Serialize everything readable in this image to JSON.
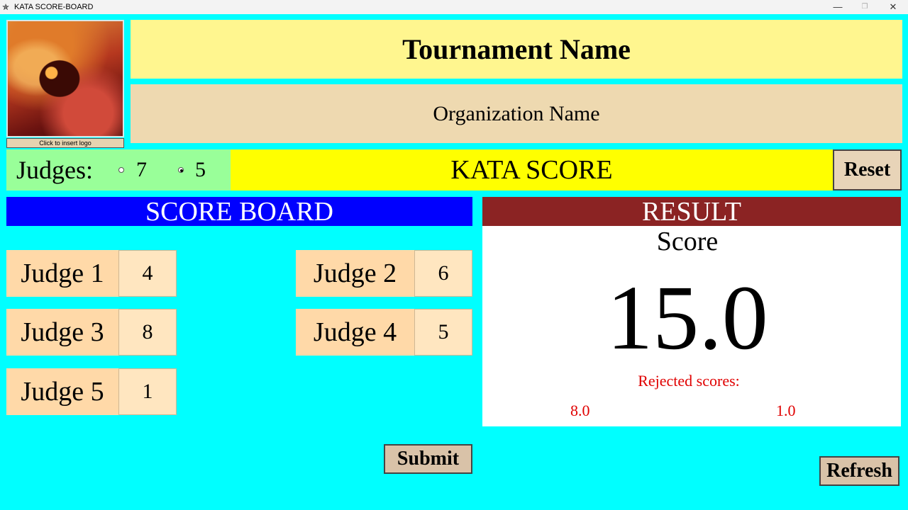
{
  "window": {
    "title": "KATA SCORE-BOARD",
    "icon": "app-icon",
    "minimize": "—",
    "maximize": "❐",
    "close": "✕"
  },
  "logo": {
    "button_label": "Click to insert logo"
  },
  "header": {
    "tournament_name": "Tournament Name",
    "organization_name": "Organization Name"
  },
  "judges_selector": {
    "label": "Judges:",
    "options": [
      {
        "label": "7",
        "selected": false
      },
      {
        "label": "5",
        "selected": true
      }
    ]
  },
  "kata_score_title": "KATA SCORE",
  "reset_label": "Reset",
  "scoreboard": {
    "title": "SCORE BOARD",
    "judges": [
      {
        "label": "Judge 1",
        "value": "4"
      },
      {
        "label": "Judge 2",
        "value": "6"
      },
      {
        "label": "Judge 3",
        "value": "8"
      },
      {
        "label": "Judge 4",
        "value": "5"
      },
      {
        "label": "Judge 5",
        "value": "1"
      }
    ]
  },
  "result": {
    "title": "RESULT",
    "score_label": "Score",
    "score_value": "15.0",
    "rejected_label": "Rejected scores:",
    "rejected": [
      "8.0",
      "1.0"
    ]
  },
  "submit_label": "Submit",
  "refresh_label": "Refresh",
  "colors": {
    "background": "#00ffff",
    "tournament_bg": "#fff68f",
    "organization_bg": "#eed9b0",
    "judges_bg": "#99ff99",
    "kata_bg": "#ffff00",
    "scoreboard_header": "#0000ff",
    "result_header": "#8b2323",
    "rejected_text": "#e00000"
  }
}
